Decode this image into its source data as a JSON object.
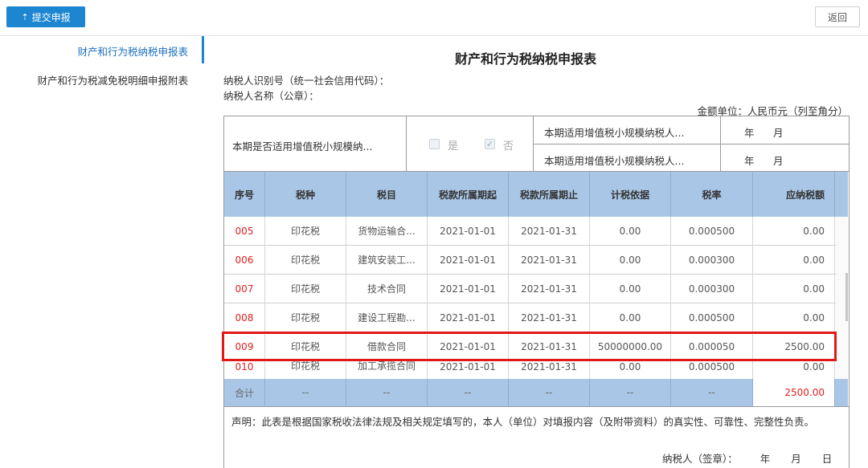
{
  "toolbar": {
    "submit_label": "提交申报",
    "back_label": "返回"
  },
  "sidebar": {
    "items": [
      {
        "label": "财产和行为税纳税申报表"
      },
      {
        "label": "财产和行为税减免税明细申报附表"
      }
    ]
  },
  "form": {
    "title": "财产和行为税纳税申报表",
    "taxpayer_id_label": "纳税人识别号（统一社会信用代码）：",
    "taxpayer_name_label": "纳税人名称（公章）：",
    "amount_unit": "金额单位：人民币元（列至角分）",
    "small_scale_question": "本期是否适用增值税小规模纳...",
    "yes_label": "是",
    "no_label": "否",
    "no_checked": true,
    "period_start_label": "本期适用增值税小规模纳税人...",
    "period_end_label": "本期适用增值税小规模纳税人...",
    "year_label": "年",
    "month_label": "月",
    "day_label": "日",
    "declaration": "声明：此表是根据国家税收法律法规及相关规定填写的，本人（单位）对填报内容（及附带资料）的真实性、可靠性、完整性负责。",
    "signature_label": "纳税人（签章）："
  },
  "table": {
    "headers": [
      "序号",
      "税种",
      "税目",
      "税款所属期起",
      "税款所属期止",
      "计税依据",
      "税率",
      "应纳税额"
    ],
    "rows": [
      [
        "005",
        "印花税",
        "货物运输合...",
        "2021-01-01",
        "2021-01-31",
        "0.00",
        "0.000500",
        "0.00"
      ],
      [
        "006",
        "印花税",
        "建筑安装工...",
        "2021-01-01",
        "2021-01-31",
        "0.00",
        "0.000300",
        "0.00"
      ],
      [
        "007",
        "印花税",
        "技术合同",
        "2021-01-01",
        "2021-01-31",
        "0.00",
        "0.000300",
        "0.00"
      ],
      [
        "008",
        "印花税",
        "建设工程勘...",
        "2021-01-01",
        "2021-01-31",
        "0.00",
        "0.000500",
        "0.00"
      ],
      [
        "009",
        "印花税",
        "借款合同",
        "2021-01-01",
        "2021-01-31",
        "50000000.00",
        "0.000050",
        "2500.00"
      ],
      [
        "010",
        "印花税",
        "加工承揽合同",
        "2021-01-01",
        "2021-01-31",
        "0.00",
        "0.000500",
        "0.00"
      ]
    ],
    "total": [
      "合计",
      "--",
      "--",
      "--",
      "--",
      "--",
      "--",
      "2500.00"
    ],
    "highlighted_row": "009"
  },
  "colors": {
    "accent": "#1d86d1",
    "header_bg": "#a9c6e6",
    "highlight": "#e01818",
    "seq_red": "#e02020"
  }
}
